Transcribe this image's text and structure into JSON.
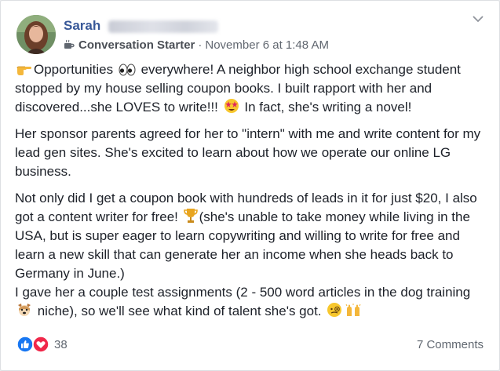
{
  "post": {
    "author_first": "Sarah",
    "badge_label": "Conversation Starter",
    "separator": "·",
    "timestamp": "November 6 at 1:48 AM",
    "p1_a": "Opportunities ",
    "p1_b": " everywhere! A neighbor high school exchange student stopped by my house selling coupon books. I built rapport with her and discovered...she LOVES to write!!! ",
    "p1_c": " In fact, she's writing a novel!",
    "p2": "Her sponsor parents agreed for her to \"intern\" with me and write content for my lead gen sites. She's excited to learn about how we operate our online LG business.",
    "p3_a": "Not only did I get a coupon book with hundreds of leads in it for just $20, I also got a content writer for free! ",
    "p3_b": "(she's unable to take money while living in the USA, but is super eager to learn copywriting and willing to write for free and learn a new skill that can generate her an income when she heads back to Germany in June.)",
    "p3_c": "I gave her a couple test assignments (2 - 500 word articles in the dog training ",
    "p3_d": " niche), so we'll see what kind of talent she's got. ",
    "icons": {
      "badge": "coffee-cup-icon",
      "menu": "chevron-down-icon",
      "emojis": [
        "pointing-hand-icon",
        "eyes-icon",
        "star-struck-icon",
        "trophy-icon",
        "dog-face-icon",
        "monocle-face-icon",
        "raised-hands-icon"
      ]
    }
  },
  "footer": {
    "reaction_count": "38",
    "comments_label": "7 Comments",
    "reaction_icons": [
      "like-icon",
      "love-icon"
    ]
  },
  "colors": {
    "author": "#385898",
    "meta": "#616770",
    "text": "#1d2129",
    "like": "#1877f2",
    "love": "#f0284a"
  }
}
